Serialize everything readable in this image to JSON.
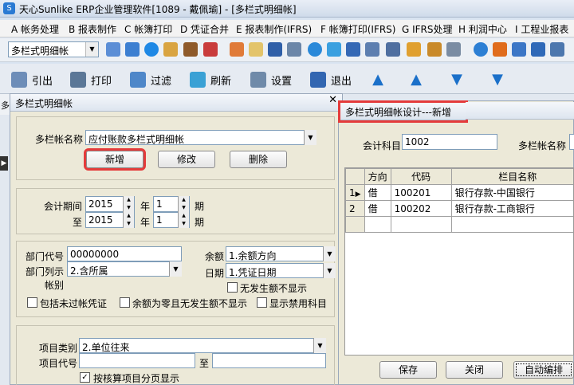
{
  "window": {
    "title": "天心Sunlike ERP企业管理软件[1089 - 戴佩瑜] - [多栏式明细帐]",
    "icon": "app-icon"
  },
  "menu": [
    "A 帐务处理",
    "B 报表制作",
    "C 帐簿打印",
    "D 凭证合并",
    "E 报表制作(IFRS)",
    "F 帐簿打印(IFRS)",
    "G IFRS处理",
    "H 利润中心",
    "I 工程业报表"
  ],
  "toolbar1": {
    "module_select": "多栏式明细帐"
  },
  "toolbar2": {
    "buttons": [
      "引出",
      "打印",
      "过滤",
      "刷新",
      "设置",
      "退出"
    ]
  },
  "left_panel": {
    "title": "多栏式明细帐",
    "behind_tab": "多",
    "name_label": "多栏帐名称",
    "name_value": "应付账款多栏式明细帐",
    "btn_new": "新增",
    "btn_edit": "修改",
    "btn_delete": "删除",
    "period_label": "会计期间",
    "to_label": "至",
    "year1": "2015",
    "year_unit": "年",
    "period1": "1",
    "period_unit": "期",
    "year2": "2015",
    "period2": "1",
    "dept_code_label": "部门代号",
    "dept_code_value": "00000000",
    "dept_list_label": "部门列示",
    "dept_list_value": "2.含所属",
    "account_label": "帐别",
    "balance_label": "余额",
    "balance_value": "1.余额方向",
    "date_label": "日期",
    "date_value": "1.凭证日期",
    "no_occ_label": "无发生额不显示",
    "include_unposted": "包括未过帐凭证",
    "zero_balance": "余额为零且无发生额不显示",
    "show_disabled": "显示禁用科目",
    "item_type_label": "项目类别",
    "item_type_value": "2.单位往来",
    "item_code_label": "项目代号",
    "item_to_label": "至",
    "page_by_item": "按核算项目分页显示"
  },
  "right_panel": {
    "title": "多栏式明细帐设计---新增",
    "account_label": "会计科目",
    "account_value": "1002",
    "name_label": "多栏帐名称",
    "columns": [
      "方向",
      "代码",
      "栏目名称"
    ],
    "rows": [
      {
        "num": "1",
        "dir": "借",
        "code": "100201",
        "name": "银行存款-中国银行"
      },
      {
        "num": "2",
        "dir": "借",
        "code": "100202",
        "name": "银行存款-工商银行"
      }
    ],
    "btn_save": "保存",
    "btn_close": "关闭",
    "btn_auto": "自动编排"
  }
}
